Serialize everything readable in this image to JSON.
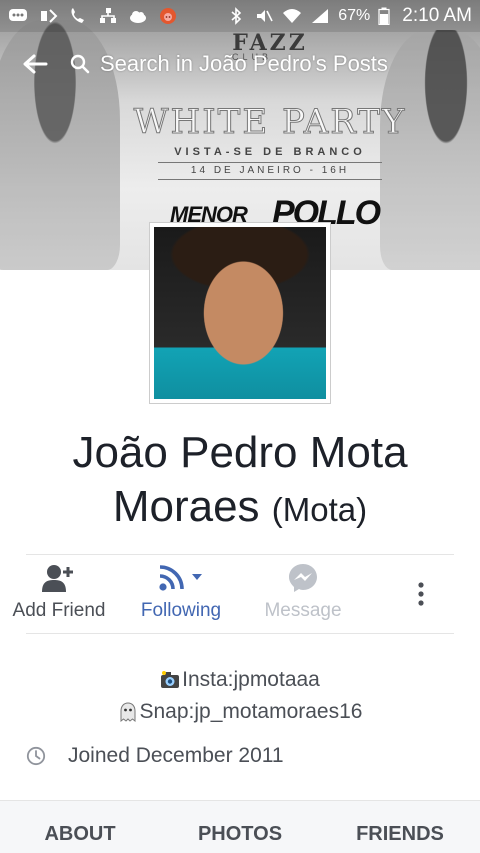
{
  "status_bar": {
    "battery": "67%",
    "time": "2:10 AM"
  },
  "header": {
    "search_placeholder": "Search in João Pedro's Posts"
  },
  "cover": {
    "club": "FAZZ",
    "club_sub": "CLUB",
    "event_title": "WHITE PARTY",
    "event_subtitle": "VISTA-SE DE BRANCO",
    "event_date": "14 DE JANEIRO - 16H",
    "artist_1": "MENOR",
    "artist_2": "POLLO"
  },
  "profile": {
    "name_line1": "João Pedro Mota",
    "name_line2": "Moraes",
    "alternate_name": "(Mota)"
  },
  "actions": {
    "add_friend": "Add Friend",
    "following": "Following",
    "message": "Message"
  },
  "bio": {
    "insta": "Insta:jpmotaaa",
    "snap": "Snap:jp_motamoraes16"
  },
  "joined": "Joined December 2011",
  "tabs": {
    "about": "ABOUT",
    "photos": "PHOTOS",
    "friends": "FRIENDS"
  },
  "colors": {
    "following_blue": "#4267b2",
    "muted_text": "#4b4f56",
    "disabled": "#bec2c9"
  }
}
